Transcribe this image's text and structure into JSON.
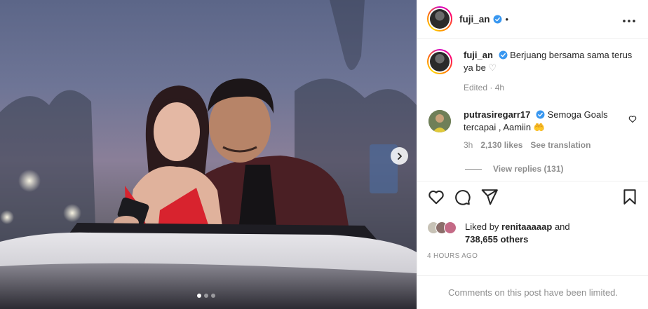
{
  "post": {
    "username": "fuji_an",
    "header_separator": "•",
    "more_icon": "more-horizontal-icon"
  },
  "caption": {
    "username": "fuji_an",
    "text": "Berjuang bersama sama terus ya be",
    "emoji": "♡",
    "meta": "Edited · 4h"
  },
  "comment": {
    "username": "putrasiregarr17",
    "text": "Semoga Goals tercapai , Aamiin",
    "emoji": "🤲",
    "time": "3h",
    "likes": "2,130 likes",
    "see_translation": "See translation",
    "view_replies": "View replies (131)"
  },
  "actions": {
    "like_icon": "heart-icon",
    "comment_icon": "comment-icon",
    "share_icon": "send-icon",
    "save_icon": "bookmark-icon"
  },
  "likes": {
    "prefix": "Liked by",
    "user": "renitaaaaap",
    "and": "and",
    "count": "738,655 others"
  },
  "timestamp": "4 HOURS AGO",
  "comments_limited": "Comments on this post have been limited.",
  "carousel": {
    "total_slides": 3,
    "active_slide": 1
  },
  "colors": {
    "verified": "#3897f0",
    "text": "#262626",
    "muted": "#8e8e8e"
  }
}
